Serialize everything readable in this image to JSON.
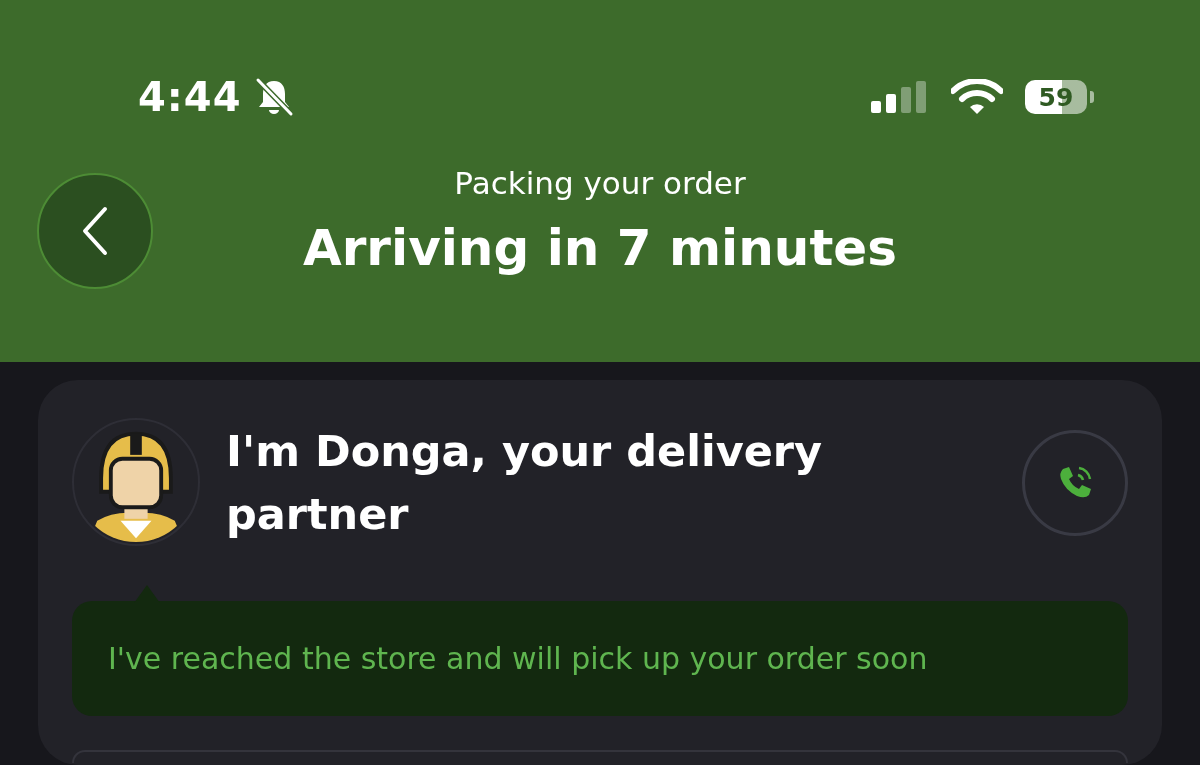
{
  "status_bar": {
    "time": "4:44",
    "silent": true,
    "battery": "59"
  },
  "header": {
    "subtitle": "Packing your order",
    "title": "Arriving in 7 minutes"
  },
  "partner": {
    "title": "I'm Donga, your delivery partner",
    "message": "I've reached the store and will pick up your order soon"
  }
}
